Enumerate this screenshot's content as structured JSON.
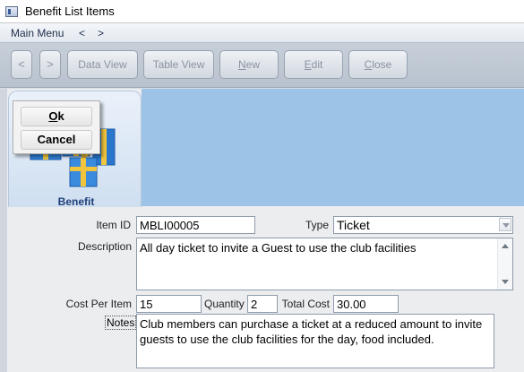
{
  "window": {
    "title": "Benefit List Items"
  },
  "menu": {
    "main": "Main Menu",
    "back": "<",
    "forward": ">"
  },
  "toolbar": {
    "back": "<",
    "forward": ">",
    "data_view": "Data View",
    "table_view": "Table View",
    "new_rest": "ew",
    "new_key": "N",
    "edit_rest": "dit",
    "edit_key": "E",
    "close_rest": "lose",
    "close_key": "C"
  },
  "tab": {
    "label": "Benefit"
  },
  "popup": {
    "ok_key": "O",
    "ok_rest": "k",
    "cancel": "Cancel"
  },
  "form": {
    "item_id_label": "Item ID",
    "item_id": "MBLI00005",
    "type_label": "Type",
    "type": "Ticket",
    "description_label": "Description",
    "description": "All day ticket to invite a Guest to use the club facilities",
    "cost_label": "Cost Per Item",
    "cost": "15",
    "quantity_label": "Quantity",
    "quantity": "2",
    "total_label": "Total Cost",
    "total": "30.00",
    "notes_label": "Notes",
    "notes": "Club members can purchase a ticket at a reduced amount to invite guests to use the club facilities for the day, food included."
  },
  "colors": {
    "banner": "#9dc3e6",
    "tab_text": "#1f3f7a"
  }
}
